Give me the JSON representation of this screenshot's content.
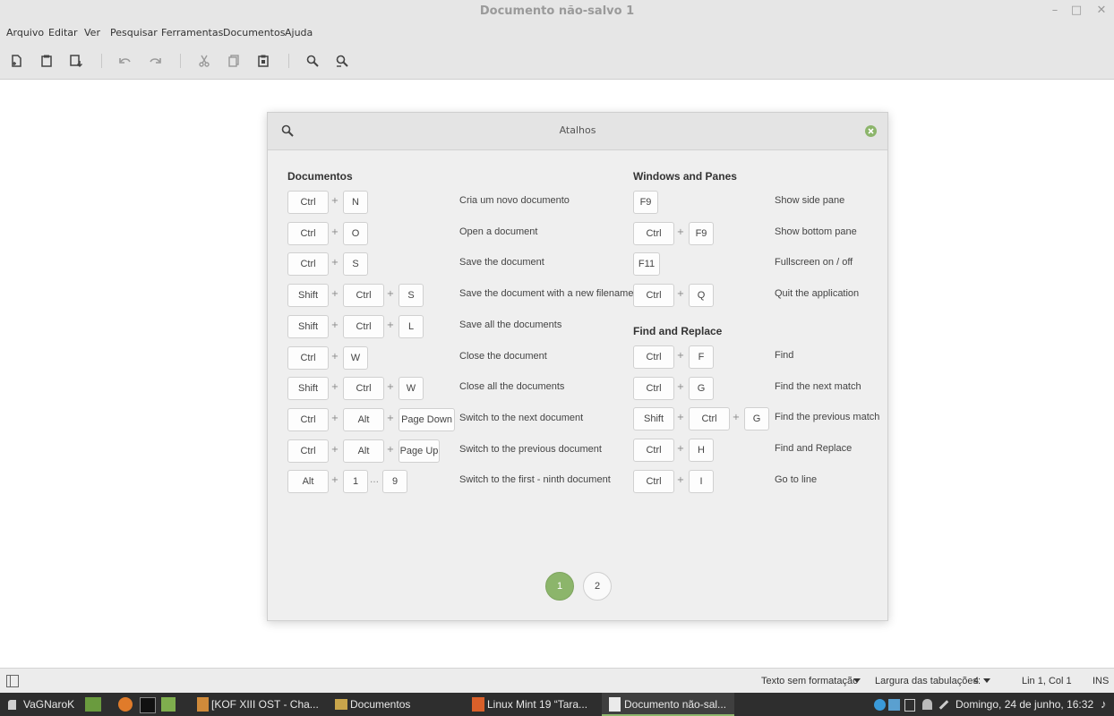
{
  "window": {
    "title": "Documento não-salvo 1",
    "minimize": "–",
    "maximize": "□",
    "close": "✕"
  },
  "menu": [
    "Arquivo",
    "Editar",
    "Ver",
    "Pesquisar",
    "Ferramentas",
    "Documentos",
    "Ajuda"
  ],
  "toolbar_icons": [
    "new-document-icon",
    "open-icon",
    "save-as-icon",
    "undo-icon",
    "redo-icon",
    "cut-icon",
    "copy-icon",
    "paste-icon",
    "search-icon",
    "search-replace-icon"
  ],
  "dialog": {
    "title": "Atalhos",
    "left": {
      "heading": "Documentos",
      "rows": [
        {
          "keys": [
            "Ctrl",
            "N"
          ],
          "desc": "Cria um novo documento"
        },
        {
          "keys": [
            "Ctrl",
            "O"
          ],
          "desc": "Open a document"
        },
        {
          "keys": [
            "Ctrl",
            "S"
          ],
          "desc": "Save the document"
        },
        {
          "keys": [
            "Shift",
            "Ctrl",
            "S"
          ],
          "desc": "Save the document with a new filename"
        },
        {
          "keys": [
            "Shift",
            "Ctrl",
            "L"
          ],
          "desc": "Save all the documents"
        },
        {
          "keys": [
            "Ctrl",
            "W"
          ],
          "desc": "Close the document"
        },
        {
          "keys": [
            "Shift",
            "Ctrl",
            "W"
          ],
          "desc": "Close all the documents"
        },
        {
          "keys": [
            "Ctrl",
            "Alt",
            "Page Down"
          ],
          "desc": "Switch to the next document"
        },
        {
          "keys": [
            "Ctrl",
            "Alt",
            "Page Up"
          ],
          "desc": "Switch to the previous document"
        },
        {
          "keys": [
            "Alt",
            "1",
            "9"
          ],
          "separator": "…",
          "desc": "Switch to the first - ninth document"
        }
      ]
    },
    "right_top": {
      "heading": "Windows and Panes",
      "rows": [
        {
          "keys": [
            "F9"
          ],
          "desc": "Show side pane"
        },
        {
          "keys": [
            "Ctrl",
            "F9"
          ],
          "desc": "Show bottom pane"
        },
        {
          "keys": [
            "F11"
          ],
          "desc": "Fullscreen on / off"
        },
        {
          "keys": [
            "Ctrl",
            "Q"
          ],
          "desc": "Quit the application"
        }
      ]
    },
    "right_bottom": {
      "heading": "Find and Replace",
      "rows": [
        {
          "keys": [
            "Ctrl",
            "F"
          ],
          "desc": "Find"
        },
        {
          "keys": [
            "Ctrl",
            "G"
          ],
          "desc": "Find the next match"
        },
        {
          "keys": [
            "Shift",
            "Ctrl",
            "G"
          ],
          "desc": "Find the previous match"
        },
        {
          "keys": [
            "Ctrl",
            "H"
          ],
          "desc": "Find and Replace"
        },
        {
          "keys": [
            "Ctrl",
            "I"
          ],
          "desc": "Go to line"
        }
      ]
    },
    "plus": "+",
    "pages": [
      "1",
      "2"
    ],
    "active_page": "1"
  },
  "statusbar": {
    "language": "Texto sem formatação",
    "tab_width_label": "Largura das tabulações:",
    "tab_width": "4",
    "position": "Lin 1, Col 1",
    "mode": "INS"
  },
  "taskbar": {
    "user": "VaGNaroK",
    "tasks": [
      "[KOF XIII OST - Cha...",
      "Documentos",
      "Linux Mint 19 “Tara...",
      "Documento não-sal..."
    ],
    "clock": "Domingo, 24 de junho, 16:32"
  },
  "colors": {
    "accent": "#8cb56b",
    "taskbar": "#2e2e2e",
    "chrome": "#e6e6e6"
  }
}
